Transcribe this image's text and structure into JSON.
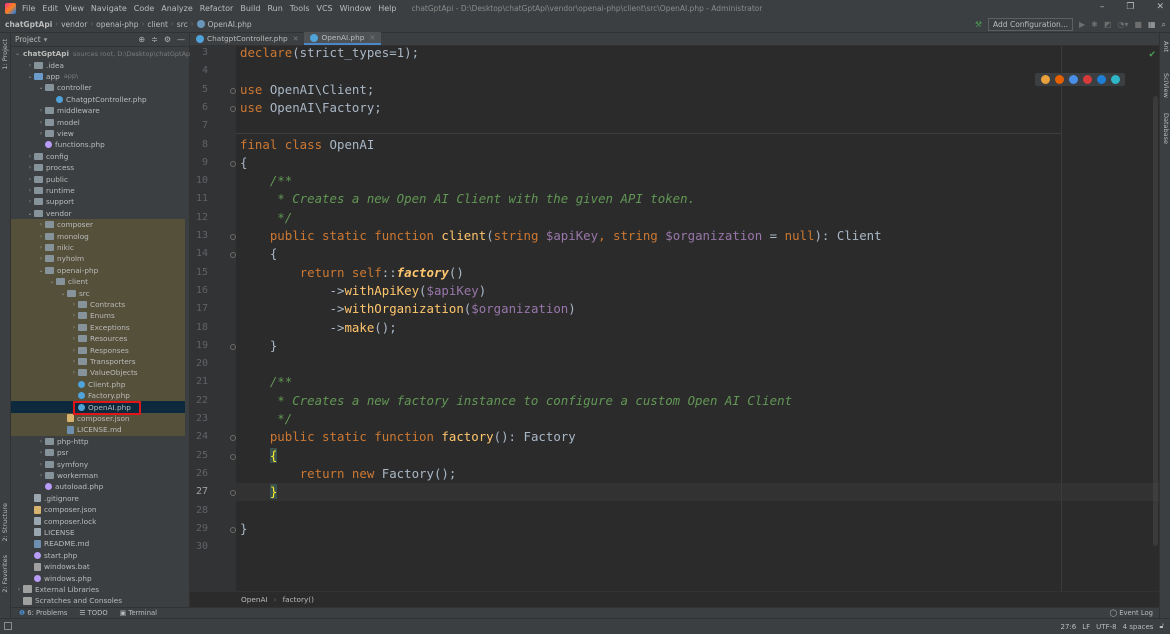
{
  "menubar": {
    "items": [
      "File",
      "Edit",
      "View",
      "Navigate",
      "Code",
      "Analyze",
      "Refactor",
      "Build",
      "Run",
      "Tools",
      "VCS",
      "Window",
      "Help"
    ],
    "window_title": "chatGptApi - D:\\Desktop\\chatGptApi\\vendor\\openai-php\\client\\src\\OpenAI.php - Administrator"
  },
  "navbar": {
    "crumbs": [
      "chatGptApi",
      "vendor",
      "openai-php",
      "client",
      "src",
      "OpenAI.php"
    ],
    "add_config": "Add Configuration..."
  },
  "project_panel": {
    "title": "Project",
    "tree": [
      {
        "label": "chatGptApi",
        "sub": "sources root, D:\\Desktop\\chatGptApi",
        "indent": 0,
        "arrow": "v",
        "icon": "folder-blue",
        "bold": true
      },
      {
        "label": ".idea",
        "indent": 1,
        "arrow": ">",
        "icon": "folder"
      },
      {
        "label": "app",
        "sub": "app\\",
        "indent": 1,
        "arrow": "v",
        "icon": "folder-blue"
      },
      {
        "label": "controller",
        "indent": 2,
        "arrow": "v",
        "icon": "folder"
      },
      {
        "label": "ChatgptController.php",
        "indent": 3,
        "icon": "phpc"
      },
      {
        "label": "middleware",
        "indent": 2,
        "arrow": ">",
        "icon": "folder"
      },
      {
        "label": "model",
        "indent": 2,
        "arrow": ">",
        "icon": "folder"
      },
      {
        "label": "view",
        "indent": 2,
        "arrow": ">",
        "icon": "folder"
      },
      {
        "label": "functions.php",
        "indent": 2,
        "icon": "php"
      },
      {
        "label": "config",
        "indent": 1,
        "arrow": ">",
        "icon": "folder"
      },
      {
        "label": "process",
        "indent": 1,
        "arrow": ">",
        "icon": "folder"
      },
      {
        "label": "public",
        "indent": 1,
        "arrow": ">",
        "icon": "folder"
      },
      {
        "label": "runtime",
        "indent": 1,
        "arrow": ">",
        "icon": "folder"
      },
      {
        "label": "support",
        "indent": 1,
        "arrow": ">",
        "icon": "folder"
      },
      {
        "label": "vendor",
        "indent": 1,
        "arrow": "v",
        "icon": "folder"
      },
      {
        "label": "composer",
        "indent": 2,
        "arrow": ">",
        "icon": "folder",
        "hl": true
      },
      {
        "label": "monolog",
        "indent": 2,
        "arrow": ">",
        "icon": "folder",
        "hl": true
      },
      {
        "label": "nikic",
        "indent": 2,
        "arrow": ">",
        "icon": "folder",
        "hl": true
      },
      {
        "label": "nyholm",
        "indent": 2,
        "arrow": ">",
        "icon": "folder",
        "hl": true
      },
      {
        "label": "openai-php",
        "indent": 2,
        "arrow": "v",
        "icon": "folder",
        "hl": true
      },
      {
        "label": "client",
        "indent": 3,
        "arrow": "v",
        "icon": "folder",
        "hl": true
      },
      {
        "label": "src",
        "indent": 4,
        "arrow": "v",
        "icon": "folder",
        "hl": true
      },
      {
        "label": "Contracts",
        "indent": 5,
        "arrow": ">",
        "icon": "folder",
        "hl": true
      },
      {
        "label": "Enums",
        "indent": 5,
        "arrow": ">",
        "icon": "folder",
        "hl": true
      },
      {
        "label": "Exceptions",
        "indent": 5,
        "arrow": ">",
        "icon": "folder",
        "hl": true
      },
      {
        "label": "Resources",
        "indent": 5,
        "arrow": ">",
        "icon": "folder",
        "hl": true
      },
      {
        "label": "Responses",
        "indent": 5,
        "arrow": ">",
        "icon": "folder",
        "hl": true
      },
      {
        "label": "Transporters",
        "indent": 5,
        "arrow": ">",
        "icon": "folder",
        "hl": true
      },
      {
        "label": "ValueObjects",
        "indent": 5,
        "arrow": ">",
        "icon": "folder",
        "hl": true
      },
      {
        "label": "Client.php",
        "indent": 5,
        "icon": "phpc",
        "hl": true
      },
      {
        "label": "Factory.php",
        "indent": 5,
        "icon": "phpc",
        "hl": true
      },
      {
        "label": "OpenAI.php",
        "indent": 5,
        "icon": "phpc",
        "sel": true
      },
      {
        "label": "composer.json",
        "indent": 4,
        "icon": "json",
        "hl": true
      },
      {
        "label": "LICENSE.md",
        "indent": 4,
        "icon": "md",
        "hl": true
      },
      {
        "label": "php-http",
        "indent": 2,
        "arrow": ">",
        "icon": "folder"
      },
      {
        "label": "psr",
        "indent": 2,
        "arrow": ">",
        "icon": "folder"
      },
      {
        "label": "symfony",
        "indent": 2,
        "arrow": ">",
        "icon": "folder"
      },
      {
        "label": "workerman",
        "indent": 2,
        "arrow": ">",
        "icon": "folder"
      },
      {
        "label": "autoload.php",
        "indent": 2,
        "icon": "php"
      },
      {
        "label": ".gitignore",
        "indent": 1,
        "icon": "txt"
      },
      {
        "label": "composer.json",
        "indent": 1,
        "icon": "json"
      },
      {
        "label": "composer.lock",
        "indent": 1,
        "icon": "txt"
      },
      {
        "label": "LICENSE",
        "indent": 1,
        "icon": "txt"
      },
      {
        "label": "README.md",
        "indent": 1,
        "icon": "md"
      },
      {
        "label": "start.php",
        "indent": 1,
        "icon": "php"
      },
      {
        "label": "windows.bat",
        "indent": 1,
        "icon": "bat"
      },
      {
        "label": "windows.php",
        "indent": 1,
        "icon": "php"
      },
      {
        "label": "External Libraries",
        "indent": 0,
        "arrow": ">",
        "icon": "lib"
      },
      {
        "label": "Scratches and Consoles",
        "indent": 0,
        "icon": "lib"
      }
    ]
  },
  "side_tabs": {
    "left": [
      "1: Project",
      "2: Structure",
      "2: Favorites"
    ],
    "right": [
      "Ant",
      "SciView",
      "Database"
    ]
  },
  "editor": {
    "tabs": [
      {
        "label": "ChatgptController.php",
        "active": false
      },
      {
        "label": "OpenAI.php",
        "active": true
      }
    ],
    "current_line": "27",
    "lines": [
      {
        "n": "3",
        "code": [
          [
            "kw",
            "declare"
          ],
          [
            "t",
            "(strict_types=1);"
          ]
        ]
      },
      {
        "n": "4",
        "code": []
      },
      {
        "n": "5",
        "code": [
          [
            "kw",
            "use "
          ],
          [
            "t",
            "OpenAI\\Client;"
          ]
        ]
      },
      {
        "n": "6",
        "code": [
          [
            "kw",
            "use "
          ],
          [
            "t",
            "OpenAI\\Factory;"
          ]
        ]
      },
      {
        "n": "7",
        "code": []
      },
      {
        "n": "8",
        "code": [
          [
            "kw",
            "final class "
          ],
          [
            "t",
            "OpenAI"
          ]
        ]
      },
      {
        "n": "9",
        "code": [
          [
            "t",
            "{"
          ]
        ]
      },
      {
        "n": "10",
        "code": [
          [
            "t",
            "    "
          ],
          [
            "cm",
            "/**"
          ]
        ]
      },
      {
        "n": "11",
        "code": [
          [
            "cm",
            "     * Creates a new Open AI Client with the given API token."
          ]
        ]
      },
      {
        "n": "12",
        "code": [
          [
            "cm",
            "     */"
          ]
        ]
      },
      {
        "n": "13",
        "code": [
          [
            "t",
            "    "
          ],
          [
            "kw",
            "public static function "
          ],
          [
            "fn",
            "client"
          ],
          [
            "t",
            "("
          ],
          [
            "kw",
            "string "
          ],
          [
            "var",
            "$apiKey"
          ],
          [
            "kw",
            ", string "
          ],
          [
            "var",
            "$organization"
          ],
          [
            "t",
            " = "
          ],
          [
            "kw",
            "null"
          ],
          [
            "t",
            "): Client"
          ]
        ]
      },
      {
        "n": "14",
        "code": [
          [
            "t",
            "    {"
          ]
        ]
      },
      {
        "n": "15",
        "code": [
          [
            "t",
            "        "
          ],
          [
            "kw",
            "return self"
          ],
          [
            "t",
            "::"
          ],
          [
            "fni",
            "factory"
          ],
          [
            "t",
            "()"
          ]
        ]
      },
      {
        "n": "16",
        "code": [
          [
            "t",
            "            ->"
          ],
          [
            "fn",
            "withApiKey"
          ],
          [
            "t",
            "("
          ],
          [
            "var",
            "$apiKey"
          ],
          [
            "t",
            ")"
          ]
        ]
      },
      {
        "n": "17",
        "code": [
          [
            "t",
            "            ->"
          ],
          [
            "fn",
            "withOrganization"
          ],
          [
            "t",
            "("
          ],
          [
            "var",
            "$organization"
          ],
          [
            "t",
            ")"
          ]
        ]
      },
      {
        "n": "18",
        "code": [
          [
            "t",
            "            ->"
          ],
          [
            "fn",
            "make"
          ],
          [
            "t",
            "();"
          ]
        ]
      },
      {
        "n": "19",
        "code": [
          [
            "t",
            "    }"
          ]
        ]
      },
      {
        "n": "20",
        "code": []
      },
      {
        "n": "21",
        "code": [
          [
            "t",
            "    "
          ],
          [
            "cm",
            "/**"
          ]
        ]
      },
      {
        "n": "22",
        "code": [
          [
            "cm",
            "     * Creates a new factory instance to configure a custom Open AI Client"
          ]
        ]
      },
      {
        "n": "23",
        "code": [
          [
            "cm",
            "     */"
          ]
        ]
      },
      {
        "n": "24",
        "code": [
          [
            "t",
            "    "
          ],
          [
            "kw",
            "public static function "
          ],
          [
            "fn",
            "factory"
          ],
          [
            "t",
            "(): Factory"
          ]
        ]
      },
      {
        "n": "25",
        "code": [
          [
            "t",
            "    "
          ],
          [
            "bh",
            "{"
          ]
        ]
      },
      {
        "n": "26",
        "code": [
          [
            "t",
            "        "
          ],
          [
            "kw",
            "return new "
          ],
          [
            "t",
            "Factory();"
          ]
        ]
      },
      {
        "n": "27",
        "code": [
          [
            "t",
            "    "
          ],
          [
            "bh",
            "}"
          ]
        ]
      },
      {
        "n": "28",
        "code": []
      },
      {
        "n": "29",
        "code": [
          [
            "t",
            "}"
          ]
        ]
      },
      {
        "n": "30",
        "code": []
      }
    ],
    "breadcrumb": [
      "OpenAI",
      "factory()"
    ]
  },
  "bottom_tabs": [
    "6: Problems",
    "TODO",
    "Terminal"
  ],
  "event_log": "Event Log",
  "statusbar": [
    "27:6",
    "LF",
    "UTF-8",
    "4 spaces"
  ],
  "colors": {
    "bg": "#2b2b2b",
    "panel": "#3c3f41",
    "selection": "#0d293e",
    "highlight": "#54503a",
    "accent": "#4a88c7"
  }
}
